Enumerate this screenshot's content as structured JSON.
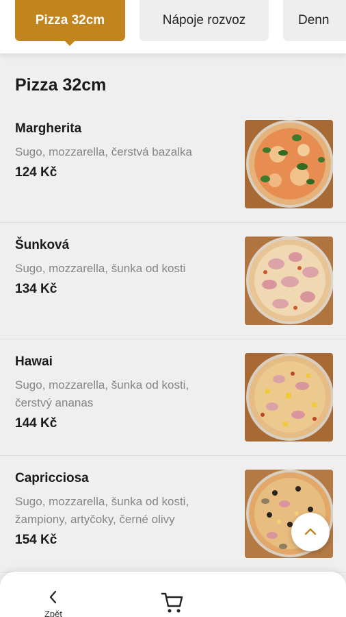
{
  "tabs": [
    {
      "label": "Pizza 32cm",
      "active": true
    },
    {
      "label": "Nápoje rozvoz",
      "active": false
    },
    {
      "label": "Denn",
      "active": false
    }
  ],
  "section_title": "Pizza 32cm",
  "items": [
    {
      "name": "Margherita",
      "desc": "Sugo, mozzarella, čerstvá bazalka",
      "price": "124 Kč"
    },
    {
      "name": "Šunková",
      "desc": "Sugo, mozzarella, šunka od kosti",
      "price": "134 Kč"
    },
    {
      "name": "Hawai",
      "desc": "Sugo, mozzarella, šunka od kosti, čerstvý ananas",
      "price": "144 Kč"
    },
    {
      "name": "Capricciosa",
      "desc": "Sugo, mozzarella, šunka od kosti, žampiony, artyčoky, černé olivy",
      "price": "154 Kč"
    }
  ],
  "bottom_nav": {
    "back_label": "Zpět",
    "back_icon": "chevron-left-icon",
    "cart_icon": "cart-icon"
  },
  "scroll_top_icon": "chevron-up-icon",
  "colors": {
    "accent": "#c2841d",
    "background": "#efefef",
    "muted_text": "#858585"
  }
}
